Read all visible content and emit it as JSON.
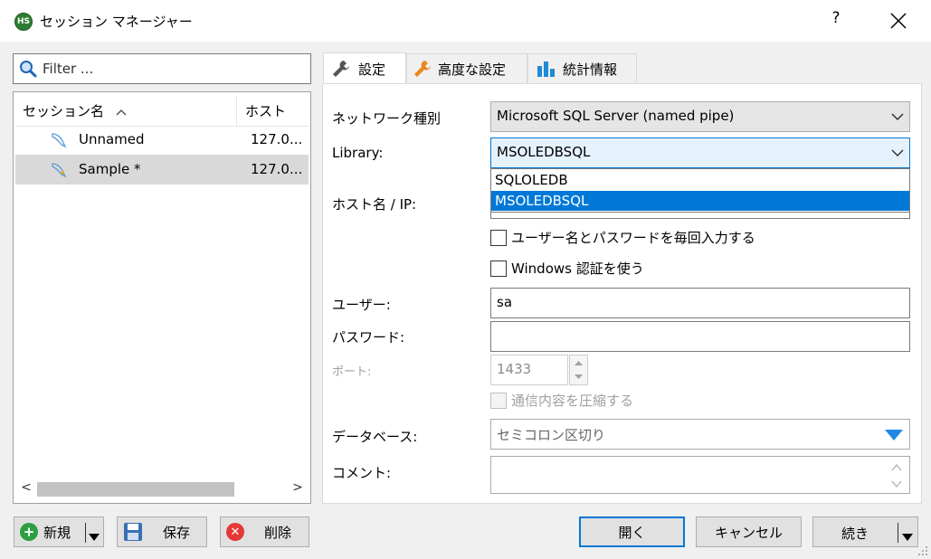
{
  "window": {
    "title": "セッション マネージャー",
    "icon_text": "HS",
    "help_label": "?",
    "close_label": "✕"
  },
  "filter": {
    "placeholder": "Filter ..."
  },
  "session_list": {
    "columns": [
      "セッション名",
      "ホスト"
    ],
    "sort_indicator": "^",
    "rows": [
      {
        "name": "Unnamed",
        "host": "127.0...",
        "selected": false
      },
      {
        "name": "Sample *",
        "host": "127.0...",
        "selected": true
      }
    ],
    "scroll_left": "<",
    "scroll_right": ">"
  },
  "left_buttons": {
    "new_label": "新規",
    "save_label": "保存",
    "delete_label": "削除"
  },
  "tabs": [
    {
      "label": "設定",
      "icon": "wrench-icon",
      "active": true
    },
    {
      "label": "高度な設定",
      "icon": "orange-wrench-icon",
      "active": false
    },
    {
      "label": "統計情報",
      "icon": "bar-chart-icon",
      "active": false
    }
  ],
  "form": {
    "network_type_label": "ネットワーク種別",
    "network_type_value": "Microsoft SQL Server (named pipe)",
    "library_label": "Library:",
    "library_value": "MSOLEDBSQL",
    "library_options": [
      "SQLOLEDB",
      "MSOLEDBSQL"
    ],
    "library_selected_index": 1,
    "host_label": "ホスト名 / IP:",
    "host_value": "",
    "prompt_credentials_label": "ユーザー名とパスワードを毎回入力する",
    "windows_auth_label": "Windows 認証を使う",
    "user_label": "ユーザー:",
    "user_value": "sa",
    "password_label": "パスワード:",
    "password_value": "",
    "port_label": "ポート:",
    "port_value": "1433",
    "compress_label": "通信内容を圧縮する",
    "database_label": "データベース:",
    "database_placeholder": "セミコロン区切り",
    "comment_label": "コメント:",
    "comment_value": ""
  },
  "right_buttons": {
    "open_label": "開く",
    "cancel_label": "キャンセル",
    "continue_label": "続き"
  },
  "colors": {
    "accent": "#0078d7",
    "new_icon": "#2e9e44",
    "delete_icon": "#e53935",
    "selected_row": "#d9d9d9",
    "database_arrow": "#1e88e5"
  }
}
